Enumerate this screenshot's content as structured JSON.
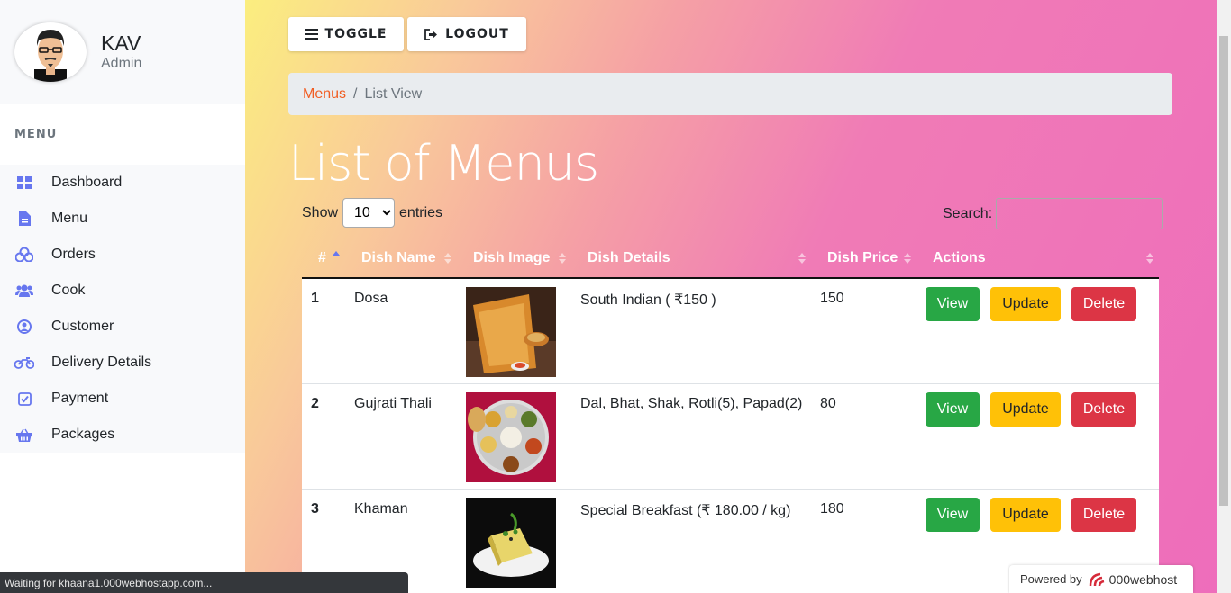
{
  "profile": {
    "name": "KAV",
    "role": "Admin"
  },
  "sidebar": {
    "heading": "MENU",
    "items": [
      {
        "label": "Dashboard",
        "icon": "dashboard-icon"
      },
      {
        "label": "Menu",
        "icon": "file-icon"
      },
      {
        "label": "Orders",
        "icon": "cubes-icon"
      },
      {
        "label": "Cook",
        "icon": "users-icon"
      },
      {
        "label": "Customer",
        "icon": "user-circle-icon"
      },
      {
        "label": "Delivery Details",
        "icon": "motorcycle-icon"
      },
      {
        "label": "Payment",
        "icon": "check-square-icon"
      },
      {
        "label": "Packages",
        "icon": "basket-icon"
      }
    ]
  },
  "toolbar": {
    "toggle_label": "TOGGLE",
    "logout_label": "LOGOUT"
  },
  "breadcrumb": {
    "parent": "Menus",
    "separator": "/",
    "current": "List View"
  },
  "page": {
    "title": "List of Menus"
  },
  "table_controls": {
    "show_label": "Show",
    "entries_value": "10",
    "entries_label": "entries",
    "search_label": "Search:",
    "search_value": ""
  },
  "table": {
    "headers": [
      "#",
      "Dish Name",
      "Dish Image",
      "Dish Details",
      "Dish Price",
      "Actions"
    ],
    "rows": [
      {
        "num": "1",
        "name": "Dosa",
        "details": "South Indian ( ₹150 )",
        "price": "150"
      },
      {
        "num": "2",
        "name": "Gujrati Thali",
        "details": "Dal, Bhat, Shak, Rotli(5), Papad(2)",
        "price": "80"
      },
      {
        "num": "3",
        "name": "Khaman",
        "details": "Special Breakfast (₹ 180.00 / kg)",
        "price": "180"
      }
    ],
    "actions": {
      "view": "View",
      "update": "Update",
      "delete": "Delete"
    }
  },
  "browser_status": "Waiting for khaana1.000webhostapp.com...",
  "badge": {
    "powered_by": "Powered by",
    "brand": "000webhost"
  },
  "colors": {
    "accent": "#6777ef",
    "link": "#f15d22",
    "view": "#28a745",
    "update": "#ffc107",
    "delete": "#dc3545"
  }
}
